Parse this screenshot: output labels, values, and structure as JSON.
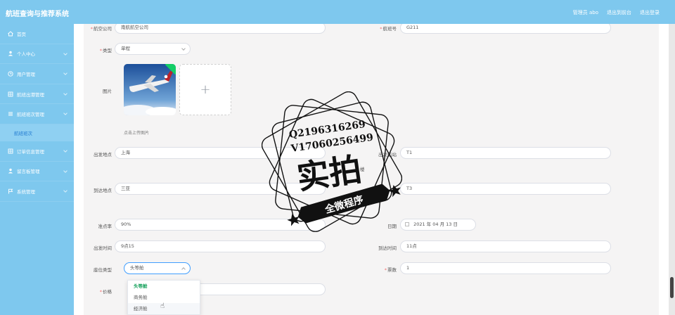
{
  "header": {
    "app_title": "航班查询与推荐系统",
    "admin_label": "管理员 abo",
    "back_to_console": "退出到前台",
    "logout": "退出登录"
  },
  "sidebar": {
    "items": [
      {
        "label": "首页",
        "icon": "home-icon"
      },
      {
        "label": "个人中心",
        "icon": "user-icon"
      },
      {
        "label": "用户管理",
        "icon": "clock-icon"
      },
      {
        "label": "航班出港管理",
        "icon": "grid-icon"
      },
      {
        "label": "航班班次管理",
        "icon": "list-icon"
      },
      {
        "label": "订单信息管理",
        "icon": "grid-icon"
      },
      {
        "label": "留言板管理",
        "icon": "user-icon"
      },
      {
        "label": "系统管理",
        "icon": "flag-icon"
      }
    ],
    "active_sub": "航班班次"
  },
  "form": {
    "airline": {
      "label": "航空公司",
      "value": "南航航空公司"
    },
    "flight_no": {
      "label": "航班号",
      "value": "G211"
    },
    "type": {
      "label": "类型",
      "value": "单程"
    },
    "image": {
      "label": "图片",
      "hint": "点击上传图片",
      "upload_plus": "+"
    },
    "depart_place": {
      "label": "出发地点",
      "value": "上海"
    },
    "depart_terminal": {
      "label": "出发航站",
      "value": "T1",
      "suffix": "楼"
    },
    "arrive_place": {
      "label": "到达地点",
      "value": "三亚"
    },
    "arrive_terminal": {
      "value": "T3",
      "suffix": "楼"
    },
    "punctuality": {
      "label": "准点率",
      "value": "90%"
    },
    "date": {
      "label": "日期",
      "value": "2021 年 04 月 13 日"
    },
    "depart_time": {
      "label": "出发时间",
      "value": "9点15"
    },
    "arrive_time": {
      "label": "到达时间",
      "value": "11点"
    },
    "seat_type": {
      "label": "座位类型",
      "value": "头等舱"
    },
    "tickets": {
      "label": "票数",
      "value": "1"
    },
    "price": {
      "label": "价格"
    },
    "seat_options": [
      "头等舱",
      "商务舱",
      "经济舱"
    ]
  },
  "watermark": {
    "line1": "Q2196316269",
    "line2": "V17060256499",
    "main": "实拍",
    "banner": "全微程序"
  },
  "colors": {
    "header_bg": "#7ec8ee",
    "required": "#f56c6c",
    "active_option": "#13a05a"
  }
}
